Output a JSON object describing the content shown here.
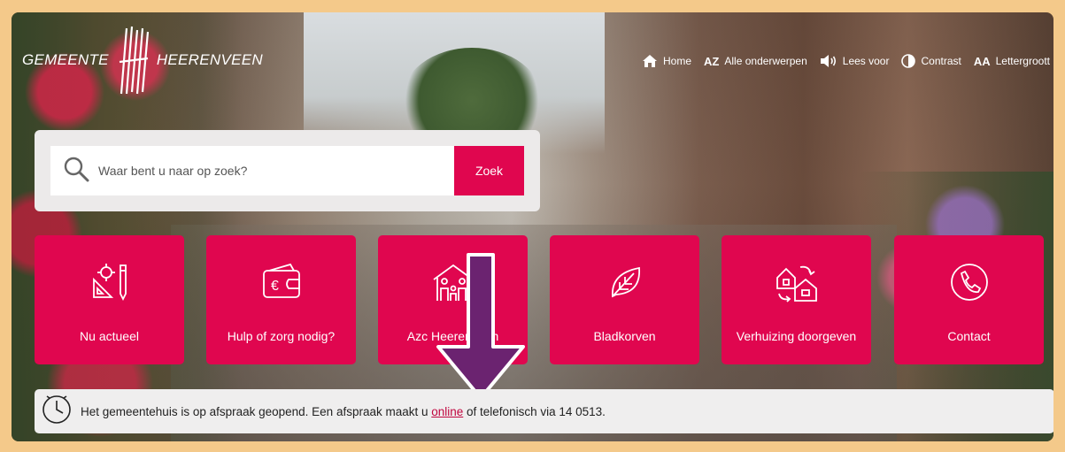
{
  "logo": {
    "left_text": "GEMEENTE",
    "right_text": "HEERENVEEN"
  },
  "topnav": {
    "items": [
      {
        "label": "Home",
        "icon": "home-icon"
      },
      {
        "label": "Alle onderwerpen",
        "icon": "a-z-icon",
        "icon_text": "AZ"
      },
      {
        "label": "Lees voor",
        "icon": "speaker-icon"
      },
      {
        "label": "Contrast",
        "icon": "contrast-icon"
      },
      {
        "label": "Lettergroott",
        "icon": "font-size-icon",
        "icon_text": "AA"
      }
    ]
  },
  "search": {
    "placeholder": "Waar bent u naar op zoek?",
    "button_label": "Zoek"
  },
  "tiles": [
    {
      "label": "Nu actueel",
      "icon": "tools-ruler-icon"
    },
    {
      "label": "Hulp of zorg nodig?",
      "icon": "wallet-euro-icon"
    },
    {
      "label": "Azc Heerenveen",
      "icon": "family-house-icon"
    },
    {
      "label": "Bladkorven",
      "icon": "leaf-icon"
    },
    {
      "label": "Verhuizing doorgeven",
      "icon": "moving-houses-icon"
    },
    {
      "label": "Contact",
      "icon": "phone-icon"
    }
  ],
  "notice": {
    "text_before": "Het gemeentehuis is op afspraak geopend. Een afspraak maakt u ",
    "link_text": "online",
    "text_after": " of telefonisch via 14 0513."
  },
  "colors": {
    "brand_pink": "#e0064f",
    "frame_border": "#f4c98a",
    "annotation_arrow": "#6b2370"
  }
}
